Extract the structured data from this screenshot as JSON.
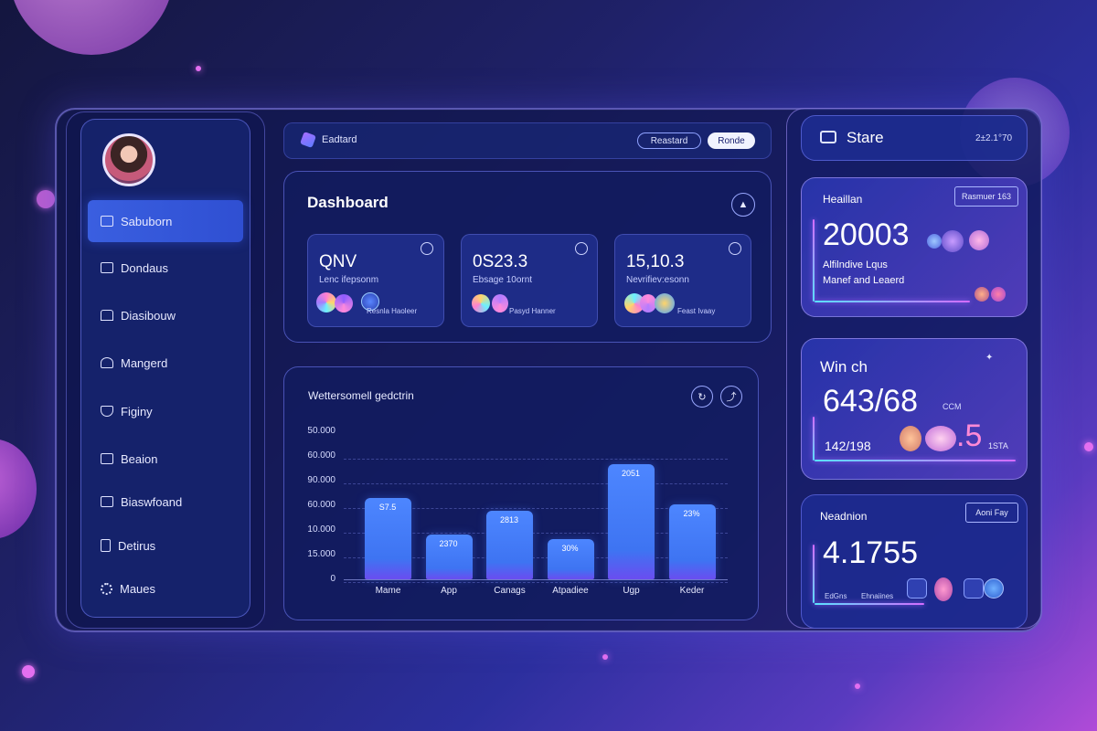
{
  "sidebar": {
    "items": [
      {
        "label": "Sabuborn",
        "icon": "grid-icon",
        "active": true
      },
      {
        "label": "Dondaus",
        "icon": "briefcase-icon"
      },
      {
        "label": "Diasibouw",
        "icon": "chart-icon"
      },
      {
        "label": "Mangerd",
        "icon": "user-icon"
      },
      {
        "label": "Figiny",
        "icon": "shield-icon"
      },
      {
        "label": "Beaion",
        "icon": "folder-icon"
      },
      {
        "label": "Biaswfoand",
        "icon": "window-icon"
      },
      {
        "label": "Detirus",
        "icon": "document-icon"
      },
      {
        "label": "Maues",
        "icon": "gear-icon"
      }
    ]
  },
  "topbar": {
    "title": "Eadtard",
    "btn_outline": "Reastard",
    "btn_solid": "Ronde"
  },
  "dashboard": {
    "title": "Dashboard",
    "stats": [
      {
        "value": "QNV",
        "sub": "Lenc ifepsonm",
        "foot": "Resnla Haoleer"
      },
      {
        "value": "0S23.3",
        "sub": "Ebsage 10ornt",
        "foot": "Pasyd Hanner"
      },
      {
        "value": "15,10.3",
        "sub": "Nevrifiev:esonn",
        "foot": "Feast Ivaay"
      }
    ]
  },
  "chart_panel": {
    "title": "Wettersomell gedctrin"
  },
  "chart_data": {
    "type": "bar",
    "title": "Wettersomell gedctrin",
    "categories": [
      "Mame",
      "App",
      "Canags",
      "Atpadiee",
      "Ugp",
      "Keder"
    ],
    "bar_labels": [
      "S7.5",
      "2370",
      "2813",
      "30%",
      "2051",
      "23%"
    ],
    "y_ticks": [
      "50.000",
      "60.000",
      "90.000",
      "60.000",
      "10.000",
      "15.000",
      "0"
    ],
    "values": [
      38,
      21,
      32,
      19,
      54,
      35
    ],
    "ylim": [
      0,
      60
    ],
    "grid": true
  },
  "right": {
    "header": {
      "title": "Stare",
      "meta": "2±2.1°70"
    },
    "card1": {
      "label": "Heaillan",
      "tag": "Rasmuer 163",
      "value": "20003",
      "line1": "Alfilndive Lqus",
      "line2": "Manef and Leaerd"
    },
    "card2": {
      "label": "Win ch",
      "value": "643/68",
      "unit": "CCM",
      "sub": "142/198",
      "side": ".5",
      "side_tag": "1STA"
    },
    "card3": {
      "label": "Neadnion",
      "tag": "Aoni Fay",
      "value": "4.1755",
      "foot1": "EdGns",
      "foot2": "Ehnaiines"
    }
  },
  "colors": {
    "accent": "#3e74f2",
    "accent_purple": "#6a4df0",
    "pink": "#d46bff",
    "cyan": "#5ae1ff"
  }
}
